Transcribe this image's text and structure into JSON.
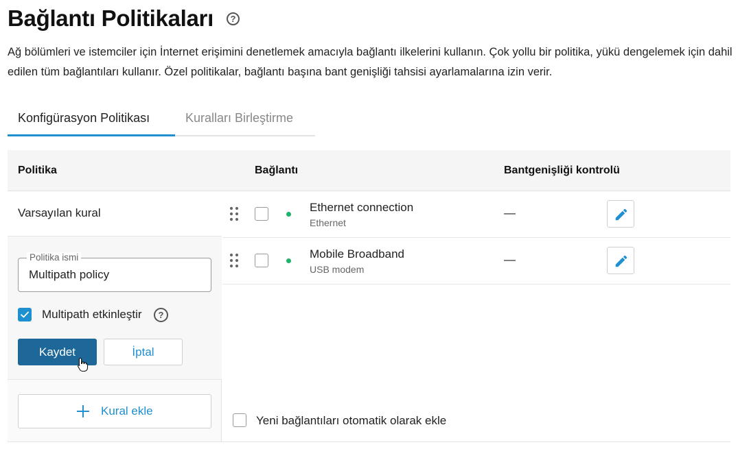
{
  "page": {
    "title": "Bağlantı Politikaları",
    "description": "Ağ bölümleri ve istemciler için İnternet erişimini denetlemek amacıyla bağlantı ilkelerini kullanın. Çok yollu bir politika, yükü dengelemek için dahil edilen tüm bağlantıları kullanır. Özel politikalar, bağlantı başına bant genişliği tahsisi ayarlamalarına izin verir."
  },
  "tabs": [
    {
      "label": "Konfigürasyon Politikası",
      "active": true
    },
    {
      "label": "Kuralları Birleştirme",
      "active": false
    }
  ],
  "table": {
    "headers": {
      "policy": "Politika",
      "connection": "Bağlantı",
      "bandwidth": "Bantgenişliği kontrolü"
    },
    "default_rule": "Varsayılan kural",
    "rows": [
      {
        "name": "Ethernet connection",
        "type": "Ethernet",
        "bandwidth": "—",
        "status_color": "#1fb36b"
      },
      {
        "name": "Mobile Broadband",
        "type": "USB modem",
        "bandwidth": "—",
        "status_color": "#1fb36b"
      }
    ]
  },
  "policy_form": {
    "name_label": "Politika ismi",
    "name_value": "Multipath policy",
    "multipath_label": "Multipath etkinleştir",
    "multipath_checked": true,
    "save_label": "Kaydet",
    "cancel_label": "İptal"
  },
  "add_rule_label": "Kural ekle",
  "auto_add_label": "Yeni bağlantıları otomatik olarak ekle",
  "colors": {
    "accent": "#1e8fcf",
    "primary_button": "#1d6899",
    "status_online": "#1fb36b"
  },
  "icons": [
    "help-circle-icon",
    "drag-handle-icon",
    "checkmark-icon",
    "pencil-icon",
    "plus-icon",
    "hand-cursor-icon"
  ]
}
